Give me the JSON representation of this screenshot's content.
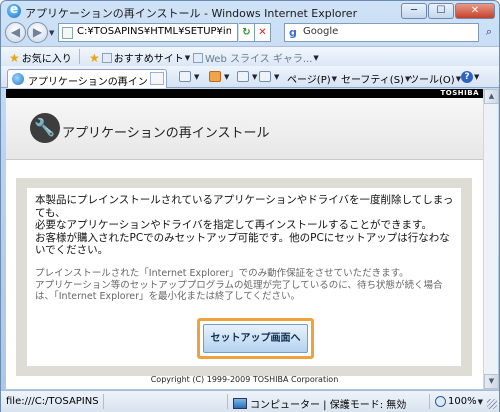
{
  "window": {
    "title": "アプリケーションの再インストール - Windows Internet Explorer",
    "min": "─",
    "max": "☐",
    "close": "✕"
  },
  "toolbar": {
    "back": "◀",
    "forward": "▶",
    "dropdown": "▼",
    "address": "C:¥TOSAPINS¥HTML¥SETUP¥index",
    "refresh": "↻",
    "stop": "✕",
    "search_engine": "Google",
    "search_icon": "⌕"
  },
  "favorites": {
    "favorites_label": "お気に入り",
    "suggested_label": "おすすめサイト",
    "web_slice_label": "Web スライス ギャラ..."
  },
  "tab": {
    "label": "アプリケーションの再インス..."
  },
  "command_bar": {
    "page": "ページ(P)",
    "safety": "セーフティ(S)",
    "tools": "ツール(O)",
    "help": "?"
  },
  "page": {
    "brand": "TOSHIBA",
    "title": "アプリケーションの再インストール",
    "message_line1": "本製品にプレインストールされているアプリケーションやドライバを一度削除してしまっても、",
    "message_line2": "必要なアプリケーションやドライバを指定して再インストールすることができます。",
    "message_line3": "お客様が購入されたPCでのみセットアップ可能です。他のPCにセットアップは行なわないでください。",
    "note_line1": "プレインストールされた「Internet Explorer」でのみ動作保証をさせていただきます。",
    "note_line2": "アプリケーション等のセットアッププログラムの処理が完了しているのに、待ち状態が続く場合は、「Internet Explorer」を最小化または終了してください。",
    "setup_button": "セットアップ画面へ",
    "copyright": "Copyright (C) 1999-2009 TOSHIBA Corporation"
  },
  "status": {
    "url": "file:///C:/TOSAPINS/H",
    "zone": "コンピューター | 保護モード: 無効",
    "zoom": "100%"
  },
  "icons": {
    "wrench": "wrench-icon",
    "ie": "ie-logo-icon"
  }
}
